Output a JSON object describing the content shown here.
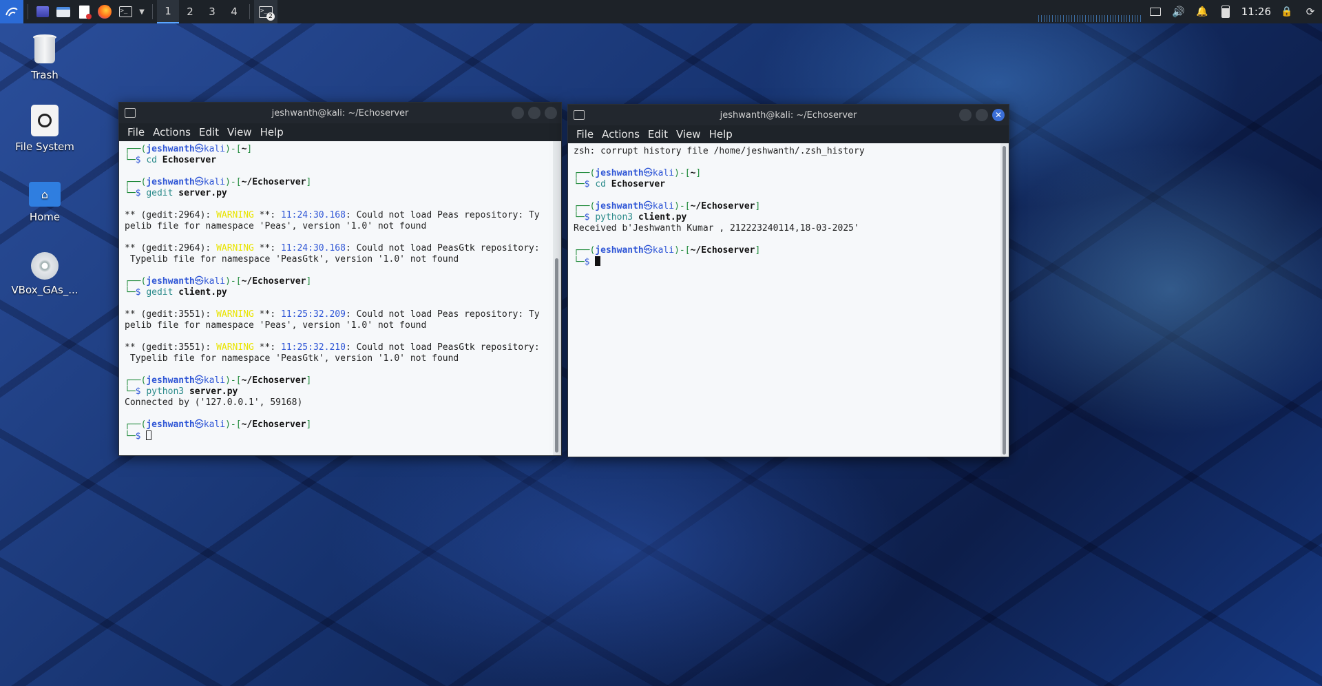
{
  "panel": {
    "workspaces": [
      "1",
      "2",
      "3",
      "4"
    ],
    "active_workspace": "1",
    "task_badge": "2",
    "clock": "11:26",
    "launchers": [
      "kali-menu-icon",
      "desktop-icon",
      "file-manager-icon",
      "text-editor-icon",
      "firefox-icon",
      "terminal-icon"
    ]
  },
  "desktop": [
    {
      "label": "Trash",
      "icon": "trash-icon"
    },
    {
      "label": "File System",
      "icon": "hard-drive-icon"
    },
    {
      "label": "Home",
      "icon": "home-folder-icon"
    },
    {
      "label": "VBox_GAs_...",
      "icon": "cd-icon"
    }
  ],
  "menus": [
    "File",
    "Actions",
    "Edit",
    "View",
    "Help"
  ],
  "left_window": {
    "title": "jeshwanth@kali: ~/Echoserver",
    "lines": [
      {
        "k": "prompt",
        "user": "jeshwanth",
        "host": "kali",
        "path": "~"
      },
      {
        "k": "cmd",
        "cmd": "cd",
        "arg": "Echoserver"
      },
      {
        "k": "blank"
      },
      {
        "k": "prompt",
        "user": "jeshwanth",
        "host": "kali",
        "path": "~/Echoserver"
      },
      {
        "k": "cmd",
        "cmd": "gedit",
        "arg": "server.py"
      },
      {
        "k": "blank"
      },
      {
        "k": "warn",
        "pre": "** (gedit:2964): ",
        "w": "WARNING",
        "mid": " **: ",
        "ts": "11:24:30.168",
        "msg": ": Could not load Peas repository: Ty"
      },
      {
        "k": "text",
        "text": "pelib file for namespace 'Peas', version '1.0' not found"
      },
      {
        "k": "blank"
      },
      {
        "k": "warn",
        "pre": "** (gedit:2964): ",
        "w": "WARNING",
        "mid": " **: ",
        "ts": "11:24:30.168",
        "msg": ": Could not load PeasGtk repository:"
      },
      {
        "k": "text",
        "text": " Typelib file for namespace 'PeasGtk', version '1.0' not found"
      },
      {
        "k": "blank"
      },
      {
        "k": "prompt",
        "user": "jeshwanth",
        "host": "kali",
        "path": "~/Echoserver"
      },
      {
        "k": "cmd",
        "cmd": "gedit",
        "arg": "client.py"
      },
      {
        "k": "blank"
      },
      {
        "k": "warn",
        "pre": "** (gedit:3551): ",
        "w": "WARNING",
        "mid": " **: ",
        "ts": "11:25:32.209",
        "msg": ": Could not load Peas repository: Ty"
      },
      {
        "k": "text",
        "text": "pelib file for namespace 'Peas', version '1.0' not found"
      },
      {
        "k": "blank"
      },
      {
        "k": "warn",
        "pre": "** (gedit:3551): ",
        "w": "WARNING",
        "mid": " **: ",
        "ts": "11:25:32.210",
        "msg": ": Could not load PeasGtk repository:"
      },
      {
        "k": "text",
        "text": " Typelib file for namespace 'PeasGtk', version '1.0' not found"
      },
      {
        "k": "blank"
      },
      {
        "k": "prompt",
        "user": "jeshwanth",
        "host": "kali",
        "path": "~/Echoserver"
      },
      {
        "k": "cmd",
        "cmd": "python3",
        "arg": "server.py"
      },
      {
        "k": "text",
        "text": "Connected by ('127.0.0.1', 59168)"
      },
      {
        "k": "blank"
      },
      {
        "k": "prompt",
        "user": "jeshwanth",
        "host": "kali",
        "path": "~/Echoserver"
      },
      {
        "k": "cursor",
        "style": "hollow"
      }
    ]
  },
  "right_window": {
    "title": "jeshwanth@kali: ~/Echoserver",
    "lines": [
      {
        "k": "text",
        "text": "zsh: corrupt history file /home/jeshwanth/.zsh_history"
      },
      {
        "k": "blank"
      },
      {
        "k": "prompt",
        "user": "jeshwanth",
        "host": "kali",
        "path": "~"
      },
      {
        "k": "cmd",
        "cmd": "cd",
        "arg": "Echoserver"
      },
      {
        "k": "blank"
      },
      {
        "k": "prompt",
        "user": "jeshwanth",
        "host": "kali",
        "path": "~/Echoserver"
      },
      {
        "k": "cmd",
        "cmd": "python3",
        "arg": "client.py"
      },
      {
        "k": "text",
        "text": "Received b'Jeshwanth Kumar , 212223240114,18-03-2025'"
      },
      {
        "k": "blank"
      },
      {
        "k": "prompt",
        "user": "jeshwanth",
        "host": "kali",
        "path": "~/Echoserver"
      },
      {
        "k": "cursor",
        "style": "solid"
      }
    ]
  },
  "colors": {
    "accent": "#3b6fd8",
    "prompt_green": "#1f8a3a",
    "prompt_blue": "#2f56d6",
    "warning": "#e9e400"
  }
}
